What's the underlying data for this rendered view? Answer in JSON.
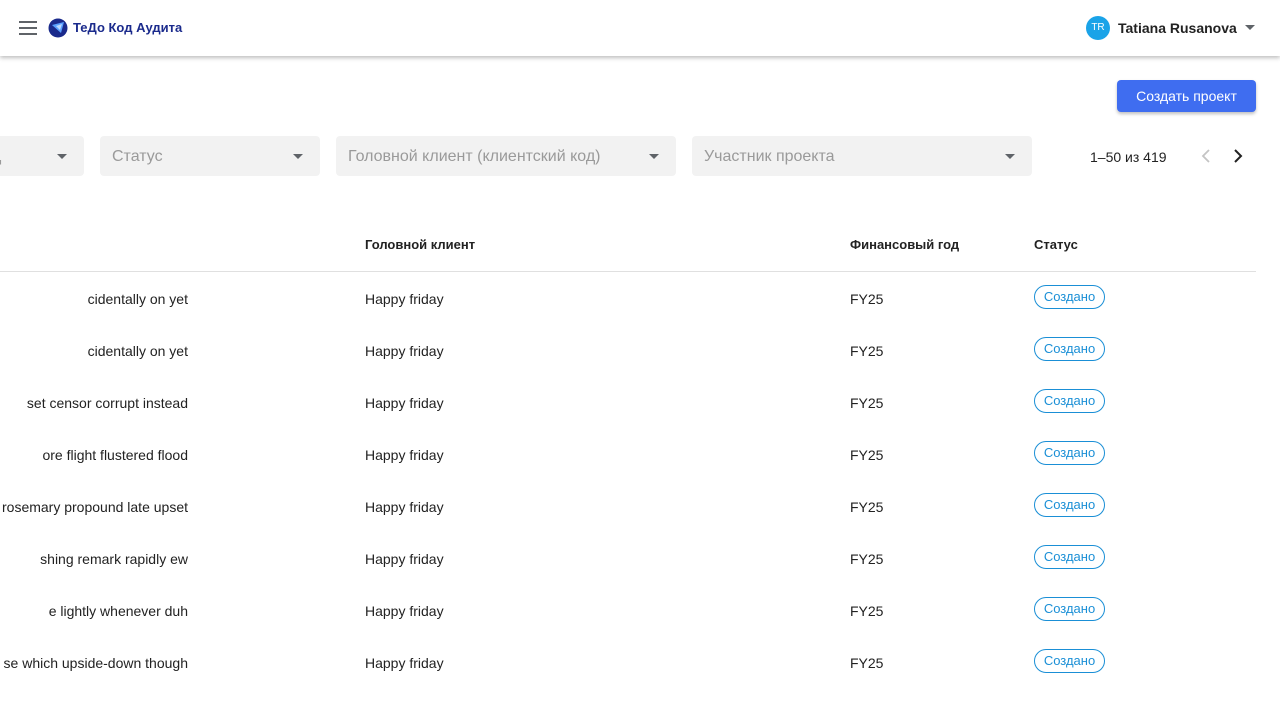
{
  "header": {
    "app_title": "ТеДо Код Аудита",
    "user": {
      "initials": "TR",
      "name": "Tatiana Rusanova"
    }
  },
  "toolbar": {
    "create_button_label": "Создать проект"
  },
  "filters": [
    {
      "label": "д"
    },
    {
      "label": "Статус"
    },
    {
      "label": "Головной клиент (клиентский код)"
    },
    {
      "label": "Участник проекта"
    }
  ],
  "pagination": {
    "range_text": "1–50 из 419"
  },
  "table": {
    "columns": {
      "client": "Головной клиент",
      "fiscal_year": "Финансовый год",
      "status": "Статус"
    },
    "rows": [
      {
        "name": "cidentally on yet",
        "client": "Happy friday",
        "fiscal_year": "FY25",
        "status": "Создано"
      },
      {
        "name": "cidentally on yet",
        "client": "Happy friday",
        "fiscal_year": "FY25",
        "status": "Создано"
      },
      {
        "name": "set censor corrupt instead",
        "client": "Happy friday",
        "fiscal_year": "FY25",
        "status": "Создано"
      },
      {
        "name": "ore flight flustered flood",
        "client": "Happy friday",
        "fiscal_year": "FY25",
        "status": "Создано"
      },
      {
        "name": "rosemary propound late upset",
        "client": "Happy friday",
        "fiscal_year": "FY25",
        "status": "Создано"
      },
      {
        "name": "shing remark rapidly ew",
        "client": "Happy friday",
        "fiscal_year": "FY25",
        "status": "Создано"
      },
      {
        "name": "e lightly whenever duh",
        "client": "Happy friday",
        "fiscal_year": "FY25",
        "status": "Создано"
      },
      {
        "name": "se which upside-down though",
        "client": "Happy friday",
        "fiscal_year": "FY25",
        "status": "Создано"
      }
    ]
  },
  "colors": {
    "accent": "#3f6df0",
    "brand": "#1a2a8c",
    "status_chip": "#1a8fd6",
    "avatar": "#1aa3e8"
  },
  "icons": [
    "menu-icon",
    "logo-icon",
    "chevron-down-icon",
    "chevron-left-icon",
    "chevron-right-icon"
  ]
}
